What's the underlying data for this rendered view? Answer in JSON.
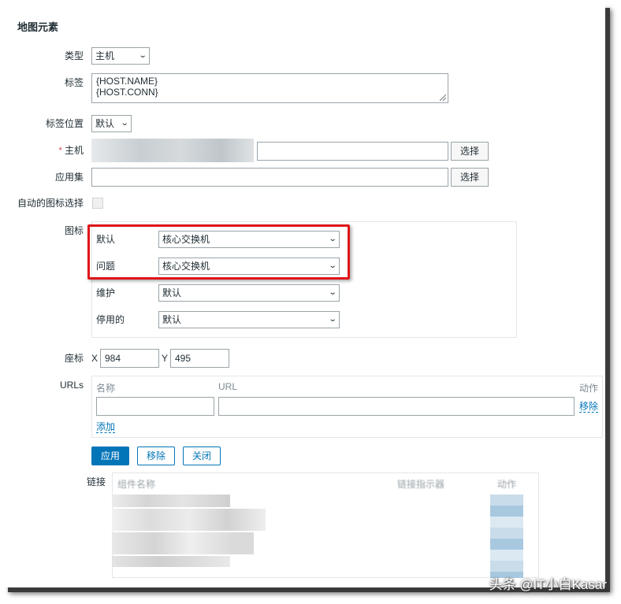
{
  "section_title": "地图元素",
  "fields": {
    "type": {
      "label": "类型",
      "value": "主机"
    },
    "label": {
      "label": "标签",
      "line1": "{HOST.NAME}",
      "line2": "{HOST.CONN}"
    },
    "label_location": {
      "label": "标签位置",
      "value": "默认"
    },
    "host": {
      "label": "主机",
      "required_mark": "*",
      "select_button": "选择"
    },
    "application": {
      "label": "应用集",
      "select_button": "选择"
    },
    "auto_icon": {
      "label": "自动的图标选择"
    },
    "icons": {
      "label": "图标",
      "rows": [
        {
          "label": "默认",
          "value": "核心交换机"
        },
        {
          "label": "问题",
          "value": "核心交换机"
        },
        {
          "label": "维护",
          "value": "默认"
        },
        {
          "label": "停用的",
          "value": "默认"
        }
      ]
    },
    "coordinates": {
      "label": "座标",
      "x_label": "X",
      "x_value": "984",
      "y_label": "Y",
      "y_value": "495"
    },
    "urls": {
      "label": "URLs",
      "col_name": "名称",
      "col_url": "URL",
      "col_action": "动作",
      "remove_link": "移除",
      "add_link": "添加"
    }
  },
  "buttons": {
    "apply": "应用",
    "remove": "移除",
    "close": "关闭"
  },
  "links_section": {
    "label": "链接",
    "col_element": "组件名称",
    "col_indicator": "链接指示器",
    "col_action": "动作"
  },
  "watermark": "头条 @IT小白Kasar",
  "colors": {
    "accent": "#0275b8",
    "highlight_box": "#e0151a"
  }
}
